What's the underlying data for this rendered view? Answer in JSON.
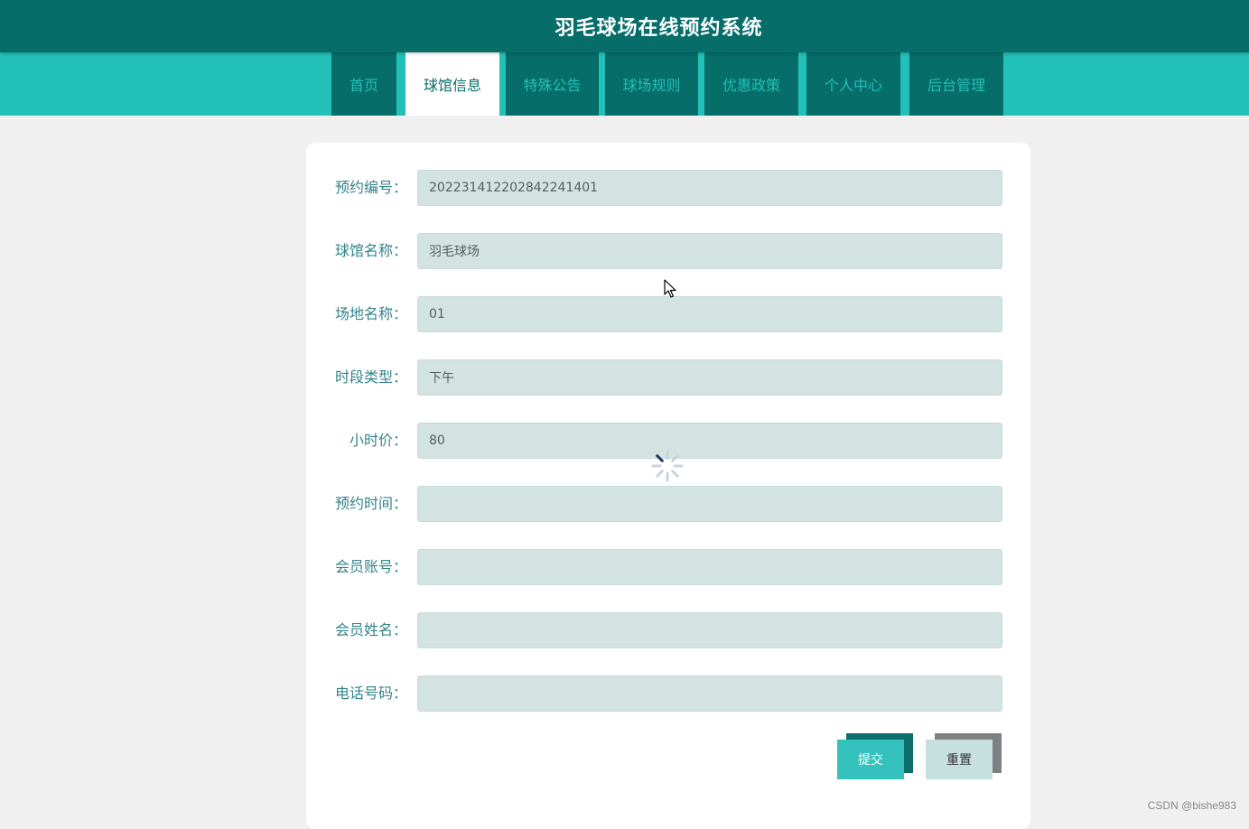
{
  "header": {
    "title": "羽毛球场在线预约系统"
  },
  "nav": {
    "items": [
      {
        "label": "首页"
      },
      {
        "label": "球馆信息"
      },
      {
        "label": "特殊公告"
      },
      {
        "label": "球场规则"
      },
      {
        "label": "优惠政策"
      },
      {
        "label": "个人中心"
      },
      {
        "label": "后台管理"
      }
    ],
    "active": "球馆信息"
  },
  "form": {
    "fields": [
      {
        "label": "预约编号：",
        "value": "202231412202842241401"
      },
      {
        "label": "球馆名称：",
        "value": "羽毛球场"
      },
      {
        "label": "场地名称：",
        "value": "01"
      },
      {
        "label": "时段类型：",
        "value": "下午"
      },
      {
        "label": "小时价：",
        "value": "80"
      },
      {
        "label": "预约时间：",
        "value": ""
      },
      {
        "label": "会员账号：",
        "value": ""
      },
      {
        "label": "会员姓名：",
        "value": ""
      },
      {
        "label": "电话号码：",
        "value": ""
      }
    ],
    "submit_label": "提交",
    "reset_label": "重置"
  },
  "watermark": "CSDN @bishe983",
  "colors": {
    "header_bg": "#066d69",
    "nav_bg": "#22c0b8",
    "accent": "#35c1bc",
    "input_bg": "#d3e3e2",
    "label": "#33838a"
  },
  "icons": {
    "loading": "loading-spinner-icon",
    "cursor": "mouse-cursor-icon"
  }
}
